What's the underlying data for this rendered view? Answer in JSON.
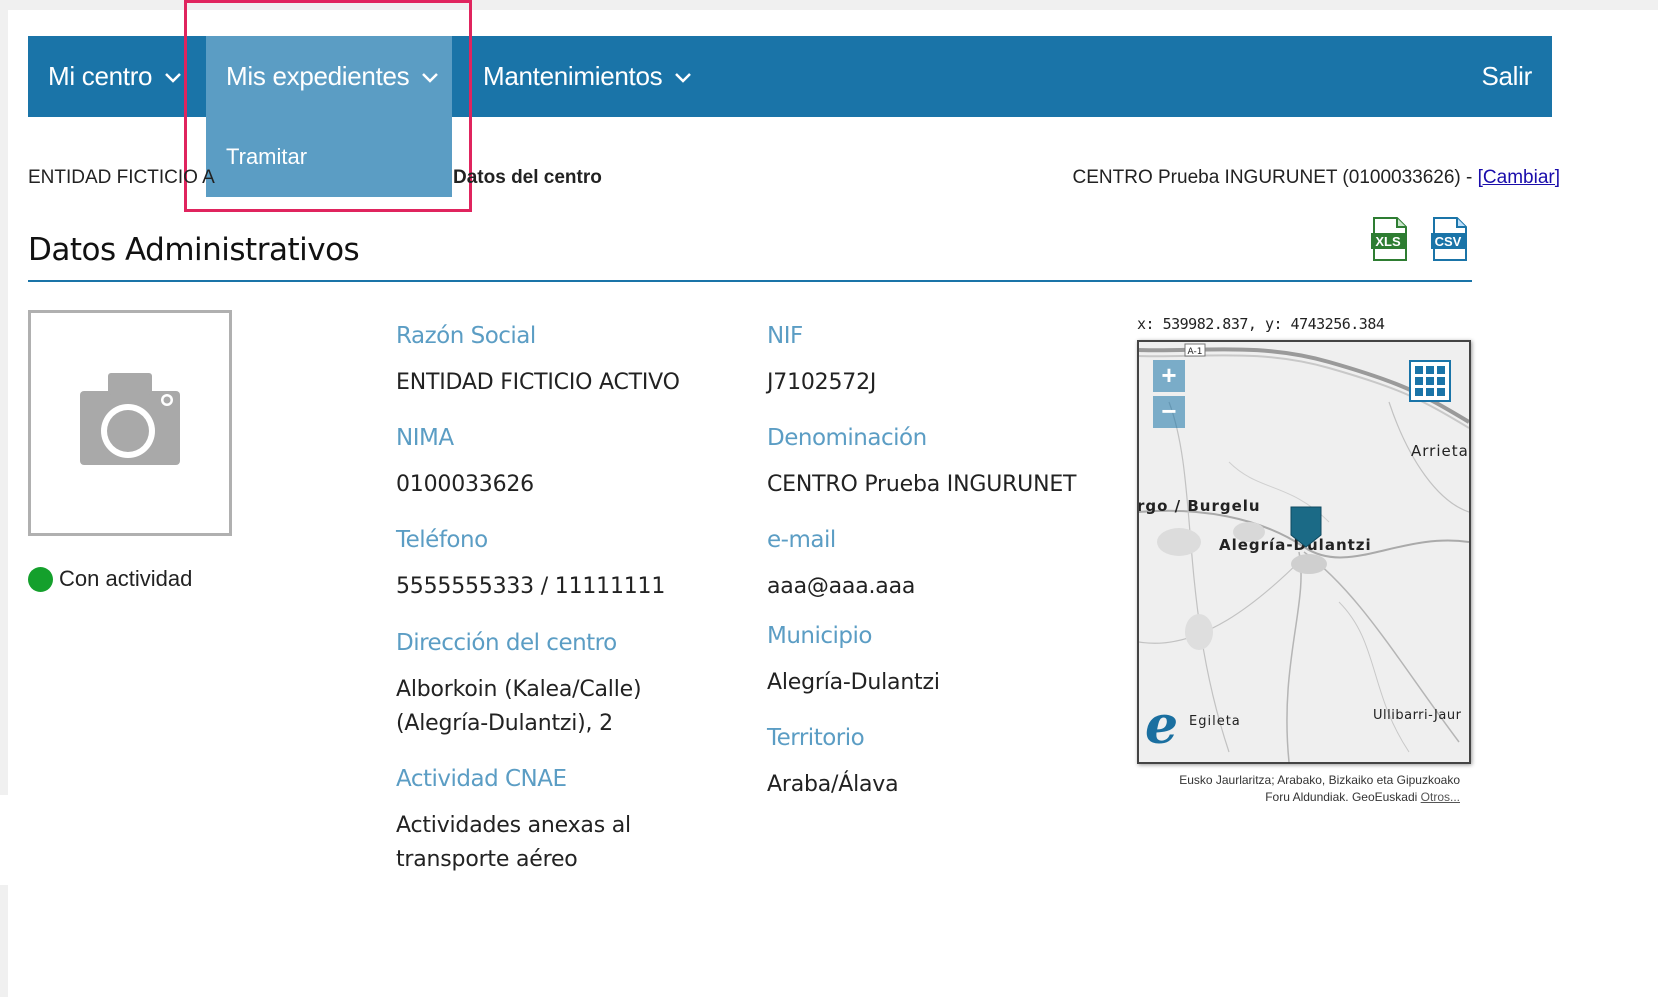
{
  "nav": {
    "items": [
      {
        "label": "Mi centro"
      },
      {
        "label": "Mis expedientes"
      },
      {
        "label": "Mantenimientos"
      }
    ],
    "logout_label": "Salir",
    "dropdown": {
      "items": [
        {
          "label": "Tramitar"
        }
      ]
    }
  },
  "breadcrumb": {
    "entity": "ENTIDAD FICTICIO A",
    "current": "Datos del centro"
  },
  "centro": {
    "text": "CENTRO Prueba INGURUNET (0100033626) - ",
    "change_link": "[Cambiar]"
  },
  "page": {
    "title": "Datos Administrativos"
  },
  "export": {
    "xls_icon": "xls-file-icon",
    "csv_icon": "csv-file-icon"
  },
  "photo": {
    "icon": "camera-icon"
  },
  "status": {
    "label": "Con actividad",
    "color": "#14a02c"
  },
  "fields": {
    "razon_social": {
      "label": "Razón Social",
      "value": "ENTIDAD FICTICIO ACTIVO"
    },
    "nif": {
      "label": "NIF",
      "value": "J7102572J"
    },
    "nima": {
      "label": "NIMA",
      "value": "0100033626"
    },
    "denominacion": {
      "label": "Denominación",
      "value": "CENTRO Prueba INGURUNET"
    },
    "telefono": {
      "label": "Teléfono",
      "value": "5555555333 / 11111111"
    },
    "email": {
      "label": "e-mail",
      "value": "aaa@aaa.aaa"
    },
    "direccion": {
      "label": "Dirección del centro",
      "value_line1": "Alborkoin (Kalea/Calle)",
      "value_line2": "(Alegría-Dulantzi), 2"
    },
    "municipio": {
      "label": "Municipio",
      "value": "Alegría-Dulantzi"
    },
    "territorio": {
      "label": "Territorio",
      "value": "Araba/Álava"
    },
    "actividad": {
      "label": "Actividad CNAE",
      "value_line1": "Actividades anexas al",
      "value_line2": "transporte aéreo"
    }
  },
  "map": {
    "coords": "x: 539982.837, y: 4743256.384",
    "zoom_in": "+",
    "zoom_out": "−",
    "road_label": "A-1",
    "places": [
      "Arrieta",
      "rgo / Burgelu",
      "Alegría-Dulantzi",
      "Egileta",
      "Ullibarri-Jaur"
    ],
    "attribution_line1": "Eusko Jaurlaritza; Arabako, Bizkaiko eta Gipuzkoako",
    "attribution_line2": "Foru Aldundiak. GeoEuskadi ",
    "attribution_link": "Otros...",
    "logo": "e",
    "colors": {
      "nav": "#1a74a8",
      "nav_active": "#5b9dc4",
      "highlight": "#e0245e"
    }
  }
}
